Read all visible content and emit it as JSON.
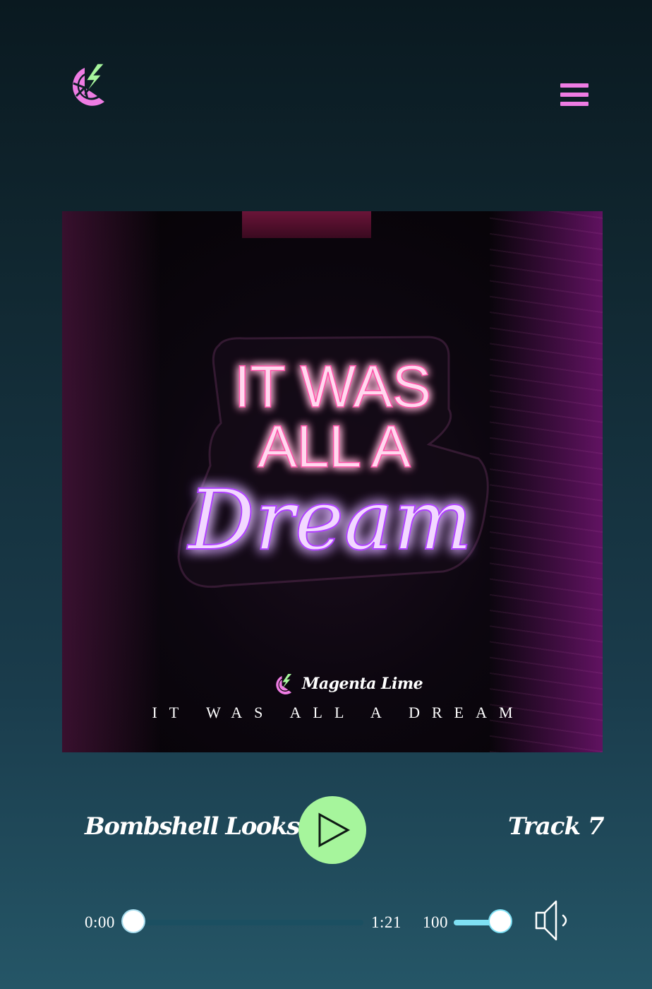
{
  "header": {
    "logo_icon": "lime-slice-lightning-icon",
    "menu_icon": "hamburger-menu-icon"
  },
  "album": {
    "neon_lines": [
      "IT WAS",
      "ALL A",
      "Dream"
    ],
    "brand_name": "Magenta Lime",
    "title": "IT WAS ALL A DREAM"
  },
  "player": {
    "track_name": "Bombshell Looks",
    "track_number": "Track 7",
    "play_icon": "play-icon",
    "current_time": "0:00",
    "total_time": "1:21",
    "progress": 0,
    "volume": "100",
    "volume_level": 1.0,
    "speaker_icon": "speaker-icon"
  },
  "colors": {
    "accent_pink": "#ee7ce3",
    "accent_lime": "#a6f59c",
    "track_fill": "#7fe0f4"
  }
}
